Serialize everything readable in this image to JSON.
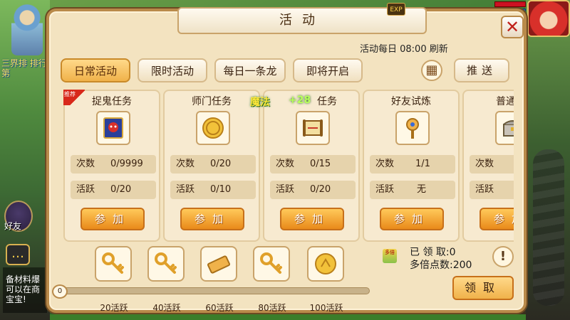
{
  "window": {
    "title": "活动",
    "exp_badge": "EXP",
    "close_glyph": "✕"
  },
  "header": {
    "refresh_note": "活动每日 08:00 刷新"
  },
  "tabs": [
    {
      "label": "日常活动",
      "active": true
    },
    {
      "label": "限时活动",
      "active": false
    },
    {
      "label": "每日一条龙",
      "active": false
    },
    {
      "label": "即将开启",
      "active": false
    }
  ],
  "push_label": "推送",
  "grid_icon": "grid-icon",
  "cards": [
    {
      "title": "捉鬼任务",
      "ribbon": "推荐",
      "icon": "ghost-book-icon",
      "count_label": "次数",
      "count": "0/9999",
      "active_label": "活跃",
      "active": "0/20",
      "button": "参加"
    },
    {
      "title": "师门任务",
      "ribbon": "",
      "icon": "gold-coin-icon",
      "count_label": "次数",
      "count": "0/20",
      "active_label": "活跃",
      "active": "0/10",
      "button": "参加"
    },
    {
      "title": "任务",
      "ribbon": "",
      "icon": "scroll-icon",
      "count_label": "次数",
      "count": "0/15",
      "active_label": "活跃",
      "active": "0/20",
      "button": "参加"
    },
    {
      "title": "好友试炼",
      "ribbon": "",
      "icon": "golden-mace-icon",
      "count_label": "次数",
      "count": "1/1",
      "active_label": "活跃",
      "active": "无",
      "button": "参加"
    },
    {
      "title": "普通挑",
      "ribbon": "",
      "icon": "treasure-chest-icon",
      "count_label": "次数",
      "count": "",
      "active_label": "活跃",
      "active": "",
      "button": "参加"
    }
  ],
  "overlay_fx": {
    "text1": "魔法",
    "text2": "+28"
  },
  "rewards": [
    {
      "icon": "golden-key-icon",
      "label": "20活跃"
    },
    {
      "icon": "golden-key-icon",
      "label": "40活跃"
    },
    {
      "icon": "gold-ingot-icon",
      "label": "60活跃"
    },
    {
      "icon": "golden-key-icon",
      "label": "80活跃"
    },
    {
      "icon": "gold-coin-icon",
      "label": "100活跃"
    }
  ],
  "progress": {
    "start": "0",
    "value": 0,
    "max": 100
  },
  "points": {
    "claimed_label": "已 领 取:0",
    "multi_label": "多倍点数:200",
    "icon_text": "多倍"
  },
  "claim_label": "领取",
  "help_glyph": "!",
  "side": {
    "rank_text": "三界排 排行第",
    "friend_label": "好友",
    "chat_icon": "chat-bubble-icon",
    "chat_text": "备材料爆可以在商宝宝!"
  }
}
